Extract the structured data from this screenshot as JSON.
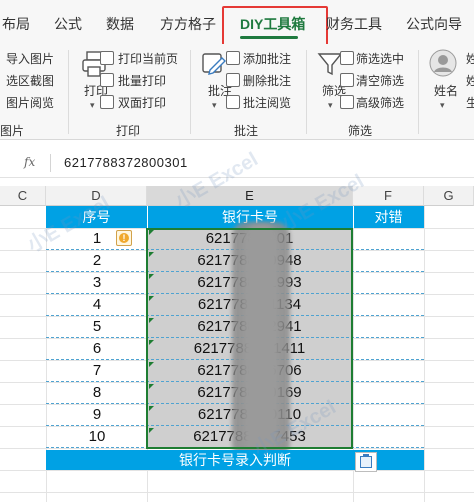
{
  "tabs": [
    "布局",
    "公式",
    "数据",
    "方方格子",
    "DIY工具箱",
    "财务工具",
    "公式向导"
  ],
  "active_tab": "DIY工具箱",
  "ribbon": {
    "left_group": {
      "items": [
        "导入图片",
        "选区截图",
        "图片阅览"
      ],
      "group_label": "图片"
    },
    "print_group": {
      "big_button": "打印",
      "items": [
        "打印当前页",
        "批量打印",
        "双面打印"
      ],
      "group_label": "打印"
    },
    "comment_group": {
      "big_button": "批注",
      "items": [
        "添加批注",
        "删除批注",
        "批注阅览"
      ],
      "group_label": "批注"
    },
    "filter_group": {
      "big_button": "筛选",
      "items": [
        "筛选选中",
        "清空筛选",
        "高级筛选"
      ],
      "group_label": "筛选"
    },
    "name_group": {
      "big_button": "姓名",
      "items": [
        "姓",
        "姓",
        "生"
      ]
    }
  },
  "formula_bar": {
    "fx_label": "fx",
    "value": "6217788372800301"
  },
  "columns": [
    "C",
    "D",
    "E",
    "F",
    "G"
  ],
  "selected_column": "E",
  "table": {
    "headers": [
      "序号",
      "银行卡号",
      "对错"
    ],
    "rows": [
      {
        "num": "1",
        "card": "62177883 01"
      },
      {
        "num": "2",
        "card": "62177883 0948"
      },
      {
        "num": "3",
        "card": "62177883 1993"
      },
      {
        "num": "4",
        "card": "62177883 1134"
      },
      {
        "num": "5",
        "card": "62177883 2941"
      },
      {
        "num": "6",
        "card": "62177883 21411"
      },
      {
        "num": "7",
        "card": "62177883 6706"
      },
      {
        "num": "8",
        "card": "62177883 0169"
      },
      {
        "num": "9",
        "card": "62177883 0110"
      },
      {
        "num": "10",
        "card": "62177883 07453"
      }
    ],
    "footer": "银行卡号录入判断"
  },
  "watermark": "小E Excel",
  "colors": {
    "accent": "#00a1e4",
    "tab_active": "#1f7a3f",
    "highlight": "#e53935",
    "selection": "#1e7d32"
  }
}
